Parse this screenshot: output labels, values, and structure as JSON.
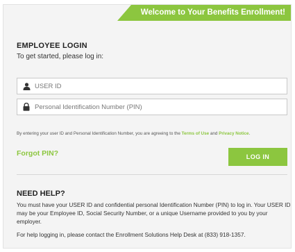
{
  "banner": {
    "title": "Welcome to Your Benefits Enrollment!"
  },
  "login": {
    "heading": "EMPLOYEE LOGIN",
    "subheading": "To get started, please log in:",
    "user_id": {
      "placeholder": "USER ID",
      "value": ""
    },
    "pin": {
      "placeholder": "Personal Identification Number (PIN)",
      "value": ""
    },
    "legal_prefix": "By entering your user ID and Personal Identification Number, you are agreeing to the",
    "terms_link": "Terms of Use",
    "legal_and": "and",
    "privacy_link": "Privacy Notice",
    "legal_suffix": ".",
    "forgot_pin": "Forgot PIN?",
    "login_button": "LOG IN"
  },
  "help": {
    "heading": "NEED HELP?",
    "paragraph1": "You must have your USER ID and confidential personal Identification Number (PIN) to log in. Your USER ID may be your Employee ID, Social Security Number, or a unique Username provided to you by your employer.",
    "paragraph2": "For help logging in, please contact the Enrollment Solutions Help Desk at (833) 918-1357."
  },
  "icons": {
    "user_field": "user-icon",
    "pin_field": "lock-icon"
  },
  "colors": {
    "accent": "#8cc63f",
    "background": "#f4f4f4"
  }
}
